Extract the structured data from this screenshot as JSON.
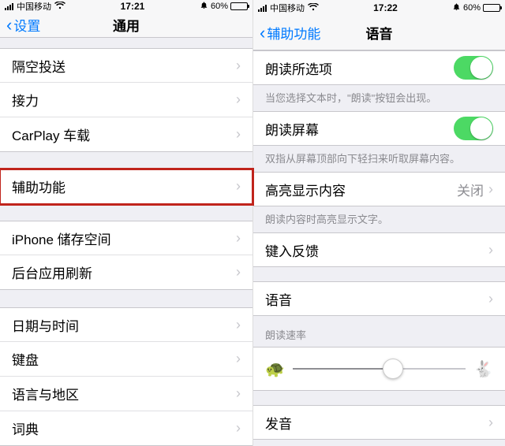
{
  "left": {
    "status": {
      "carrier": "中国移动",
      "time": "17:21",
      "battery_pct": "60%"
    },
    "nav": {
      "back": "设置",
      "title": "通用"
    },
    "group1": [
      {
        "label": "隔空投送"
      },
      {
        "label": "接力"
      },
      {
        "label": "CarPlay 车载"
      }
    ],
    "group2": [
      {
        "label": "辅助功能",
        "highlighted": true
      }
    ],
    "group3": [
      {
        "label": "iPhone 储存空间"
      },
      {
        "label": "后台应用刷新"
      }
    ],
    "group4": [
      {
        "label": "日期与时间"
      },
      {
        "label": "键盘"
      },
      {
        "label": "语言与地区"
      },
      {
        "label": "词典"
      }
    ]
  },
  "right": {
    "status": {
      "carrier": "中国移动",
      "time": "17:22",
      "battery_pct": "60%"
    },
    "nav": {
      "back": "辅助功能",
      "title": "语音"
    },
    "row_speak_selection": {
      "label": "朗读所选项",
      "on": true
    },
    "note_speak_selection": "当您选择文本时，\"朗读\"按钮会出现。",
    "row_speak_screen": {
      "label": "朗读屏幕",
      "on": true
    },
    "note_speak_screen": "双指从屏幕顶部向下轻扫来听取屏幕内容。",
    "row_highlight": {
      "label": "高亮显示内容",
      "detail": "关闭"
    },
    "note_highlight": "朗读内容时高亮显示文字。",
    "row_typing_feedback": {
      "label": "键入反馈"
    },
    "row_voice": {
      "label": "语音"
    },
    "rate_header": "朗读速率",
    "row_pronunciation": {
      "label": "发音"
    }
  }
}
